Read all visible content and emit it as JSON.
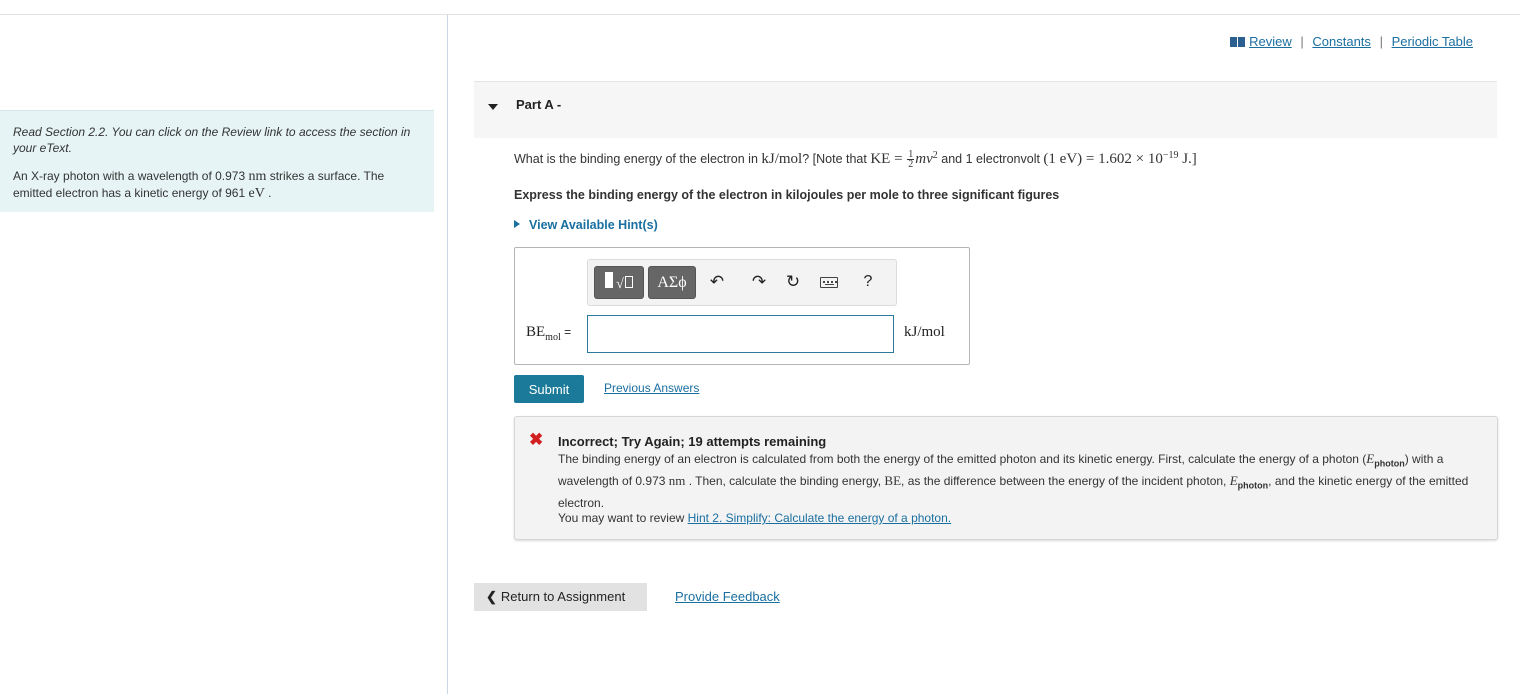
{
  "intro": {
    "note": "Read Section 2.2. You can click on the Review link to access the section in your eText.",
    "problem_prefix": "An X-ray photon with a wavelength of 0.973 ",
    "problem_unit1": "nm",
    "problem_mid": " strikes a surface. The emitted electron has a kinetic energy of 961 ",
    "problem_unit2": "eV",
    "problem_suffix": " ."
  },
  "resource_links": {
    "icon": "book-icon",
    "review": "Review",
    "constants": "Constants",
    "periodic_table": "Periodic Table",
    "separator": "|"
  },
  "part": {
    "title": "Part A -",
    "caret_icon": "caret-down-icon"
  },
  "question": {
    "prefix": "What is the binding energy of the electron in ",
    "unit": "kJ/mol",
    "note_start": "? [Note that ",
    "ke": "KE",
    "equals": " = ",
    "frac_num": "1",
    "frac_den": "2",
    "mv": "mv",
    "mv_exp": "2",
    "and_text": " and 1 electronvolt ",
    "ev_def": "(1 eV)",
    "value": " = 1.602 × 10",
    "value_exp": "−19",
    "value_unit": " J.]"
  },
  "instruction": "Express the binding energy of the electron in kilojoules per mole to three significant figures",
  "hint_toggle": "View Available Hint(s)",
  "answer": {
    "label_main": "BE",
    "label_sub": "mol",
    "label_eq": " =",
    "value": "",
    "placeholder": "",
    "unit": "kJ/mol",
    "toolbar": {
      "templates_icon": "templates-icon",
      "greek_label": "ΑΣϕ",
      "undo_icon": "undo-icon",
      "redo_icon": "redo-icon",
      "reset_icon": "reset-icon",
      "keyboard_icon": "keyboard-icon",
      "help_label": "?"
    }
  },
  "actions": {
    "submit": "Submit",
    "previous_answers": "Previous Answers"
  },
  "feedback": {
    "icon": "x-icon",
    "status_color": "#d21f1f",
    "title": "Incorrect; Try Again; 19 attempts remaining",
    "body_1": "The binding energy of an electron is calculated from both the energy of the emitted photon and its kinetic energy. First, calculate the energy of a photon (",
    "e_symbol": "E",
    "e_sub": "photon",
    "body_2": ") with a wavelength of 0.973 ",
    "nm": "nm",
    "body_3": " . Then, calculate the binding energy, ",
    "be": "BE",
    "body_4": ", as the difference between the energy of the incident photon, ",
    "body_5": ", and the kinetic energy of the emitted electron.",
    "review_prefix": "You may want to review ",
    "review_link": "Hint 2. Simplify: Calculate the energy of a photon."
  },
  "footer": {
    "return_label": "Return to Assignment",
    "return_icon": "chevron-left-icon",
    "provide_feedback": "Provide Feedback"
  },
  "colors": {
    "link": "#1a6fa0",
    "submit_bg": "#1b7a99",
    "intro_bg": "#e6f4f6",
    "error": "#d21f1f"
  }
}
